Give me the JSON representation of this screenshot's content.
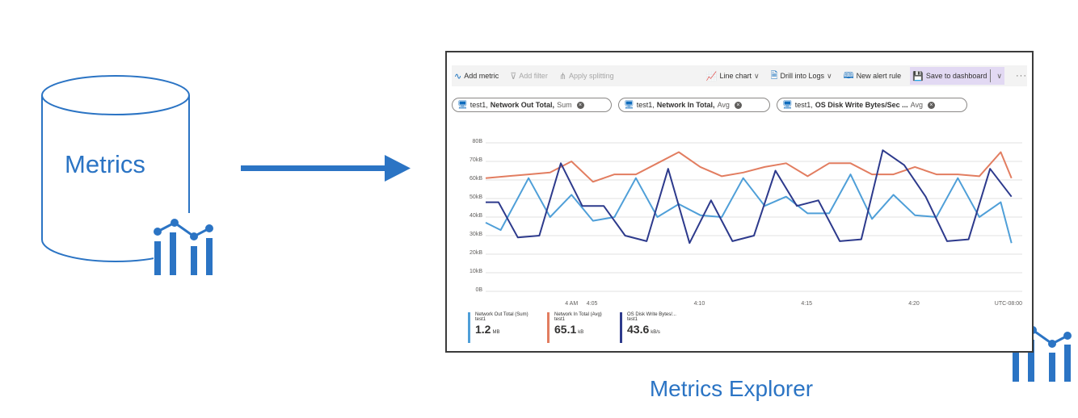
{
  "store": {
    "label": "Metrics"
  },
  "explorer": {
    "caption": "Metrics Explorer"
  },
  "toolbar": {
    "add_metric": "Add metric",
    "add_filter": "Add filter",
    "apply_splitting": "Apply splitting",
    "chart_type": "Line chart",
    "drill_logs": "Drill into Logs",
    "new_alert": "New alert rule",
    "save_dashboard": "Save to dashboard",
    "more": "···"
  },
  "metrics": [
    {
      "resource": "test1,",
      "name": "Network Out Total,",
      "agg": "Sum"
    },
    {
      "resource": "test1,",
      "name": "Network In Total,",
      "agg": "Avg"
    },
    {
      "resource": "test1,",
      "name": "OS Disk Write Bytes/Sec ...",
      "agg": "Avg"
    }
  ],
  "colors": {
    "accent": "#2b74c4",
    "series_out": "#4f9fd8",
    "series_in": "#e27d60",
    "series_disk": "#2d3a8c"
  },
  "chart_data": {
    "type": "line",
    "y_ticks": [
      "80B",
      "70kB",
      "60kB",
      "50kB",
      "40kB",
      "30kB",
      "20kB",
      "10kB",
      "0B"
    ],
    "ylim": [
      0,
      80
    ],
    "x_ticks": [
      {
        "label": "4 AM",
        "x": 4
      },
      {
        "label": "4:05",
        "x": 5
      },
      {
        "label": "4:10",
        "x": 10
      },
      {
        "label": "4:15",
        "x": 15
      },
      {
        "label": "4:20",
        "x": 20
      },
      {
        "label": "UTC-08:00",
        "x": 25
      }
    ],
    "xlim": [
      0,
      25
    ],
    "grid": true,
    "series": [
      {
        "name": "Network Out Total (Sum)",
        "color": "#4f9fd8",
        "x": [
          0,
          0.7,
          2,
          3,
          4,
          5,
          6,
          7,
          8,
          9,
          10,
          11,
          12,
          13,
          14,
          15,
          16,
          17,
          18,
          19,
          20,
          21,
          22,
          23,
          24,
          24.5
        ],
        "values": [
          37,
          33,
          61,
          40,
          52,
          38,
          40,
          61,
          40,
          47,
          41,
          40,
          61,
          46,
          51,
          42,
          42,
          63,
          39,
          52,
          41,
          40,
          61,
          40,
          48,
          26
        ]
      },
      {
        "name": "Network In Total (Avg)",
        "color": "#e27d60",
        "x": [
          0,
          1,
          2,
          3,
          4,
          5,
          6,
          7,
          8,
          9,
          10,
          11,
          12,
          13,
          14,
          15,
          16,
          17,
          18,
          19,
          20,
          21,
          22,
          23,
          24,
          24.5
        ],
        "values": [
          61,
          62,
          63,
          64,
          70,
          59,
          63,
          63,
          69,
          75,
          67,
          62,
          64,
          67,
          69,
          62,
          69,
          69,
          63,
          63,
          67,
          63,
          63,
          62,
          75,
          61
        ]
      },
      {
        "name": "OS Disk Write Bytes/Sec (Avg)",
        "color": "#2d3a8c",
        "x": [
          0,
          0.6,
          1.5,
          2.5,
          3.5,
          4.5,
          5.5,
          6.5,
          7.5,
          8.5,
          9.5,
          10.5,
          11.5,
          12.5,
          13.5,
          14.5,
          15.5,
          16.5,
          17.5,
          18.5,
          19.5,
          20.5,
          21.5,
          22.5,
          23.5,
          24.5
        ],
        "values": [
          48,
          48,
          29,
          30,
          69,
          46,
          46,
          30,
          27,
          66,
          26,
          49,
          27,
          30,
          65,
          46,
          49,
          27,
          28,
          76,
          68,
          51,
          27,
          28,
          66,
          51
        ]
      }
    ],
    "legend": [
      {
        "name": "Network Out Total (Sum)",
        "resource": "test1",
        "value": "1.2",
        "unit": "MB",
        "color": "#4f9fd8"
      },
      {
        "name": "Network In Total (Avg)",
        "resource": "test1",
        "value": "65.1",
        "unit": "kB",
        "color": "#e27d60"
      },
      {
        "name": "OS Disk Write Bytes/...",
        "resource": "test1",
        "value": "43.6",
        "unit": "kB/s",
        "color": "#2d3a8c"
      }
    ]
  }
}
